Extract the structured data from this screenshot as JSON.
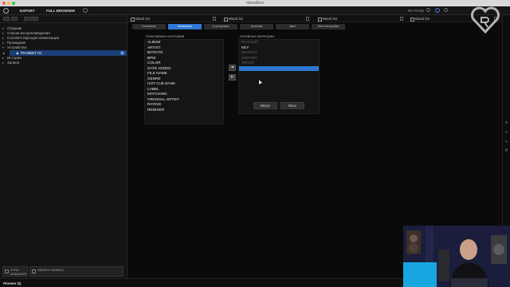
{
  "window": {
    "title": "rekordbox"
  },
  "colors": {
    "accent": "#2f78d3",
    "selection": "#1c3e77",
    "background": "#0a0a0a"
  },
  "toolbar": {
    "export_label": "EXPORT",
    "browser_label": "FULL BROWSER",
    "my_page_label": "MY PAGE"
  },
  "decks": [
    {
      "label": "Blank list"
    },
    {
      "label": "Blank list"
    },
    {
      "label": "Blank list"
    },
    {
      "label": "Blank list"
    }
  ],
  "tabs": [
    {
      "label": "Основные"
    },
    {
      "label": "Категории"
    },
    {
      "label": "Сортировка"
    },
    {
      "label": "Колонки"
    },
    {
      "label": "Цвет"
    },
    {
      "label": "Мои настройки"
    }
  ],
  "active_tab_index": 1,
  "sidebar": {
    "items": [
      {
        "label": "Сборник"
      },
      {
        "label": "Списки воспроизведения"
      },
      {
        "label": "Соответствующая композиция"
      },
      {
        "label": "Проводник"
      },
      {
        "label": "Устройства"
      },
      {
        "label": "TR-MEET 01",
        "selected": true
      },
      {
        "label": "История"
      },
      {
        "label": "Записи"
      }
    ],
    "sync_label": "SYNC MANAGER",
    "search_label": "SEARCH MOBILE"
  },
  "inactive": {
    "heading": "Неактивные категории",
    "items": [
      "ALBUM",
      "ARTIST",
      "BITRATE",
      "BPM",
      "COLOR",
      "DATE ADDED",
      "FILE NAME",
      "GENRE",
      "HOT CUE BANK",
      "LABEL",
      "MATCHING",
      "ORIGINAL ARTIST",
      "RATING",
      "REMIXER"
    ]
  },
  "active": {
    "heading": "Активные категории",
    "items": [
      {
        "label": "PLAYLIST",
        "dim": true
      },
      {
        "label": "KEY",
        "dim": false
      },
      {
        "label": "SEARCH",
        "dim": true
      },
      {
        "label": "HISTORY",
        "dim": true
      },
      {
        "label": "TRACK",
        "dim": true
      },
      {
        "label": "",
        "highlight": true
      }
    ],
    "up_label": "Вверх",
    "down_label": "Вниз"
  },
  "status": {
    "brand": "Pioneer Dj"
  },
  "icons": {
    "move_right": "right-arrow-icon",
    "move_left": "left-arrow-icon"
  }
}
